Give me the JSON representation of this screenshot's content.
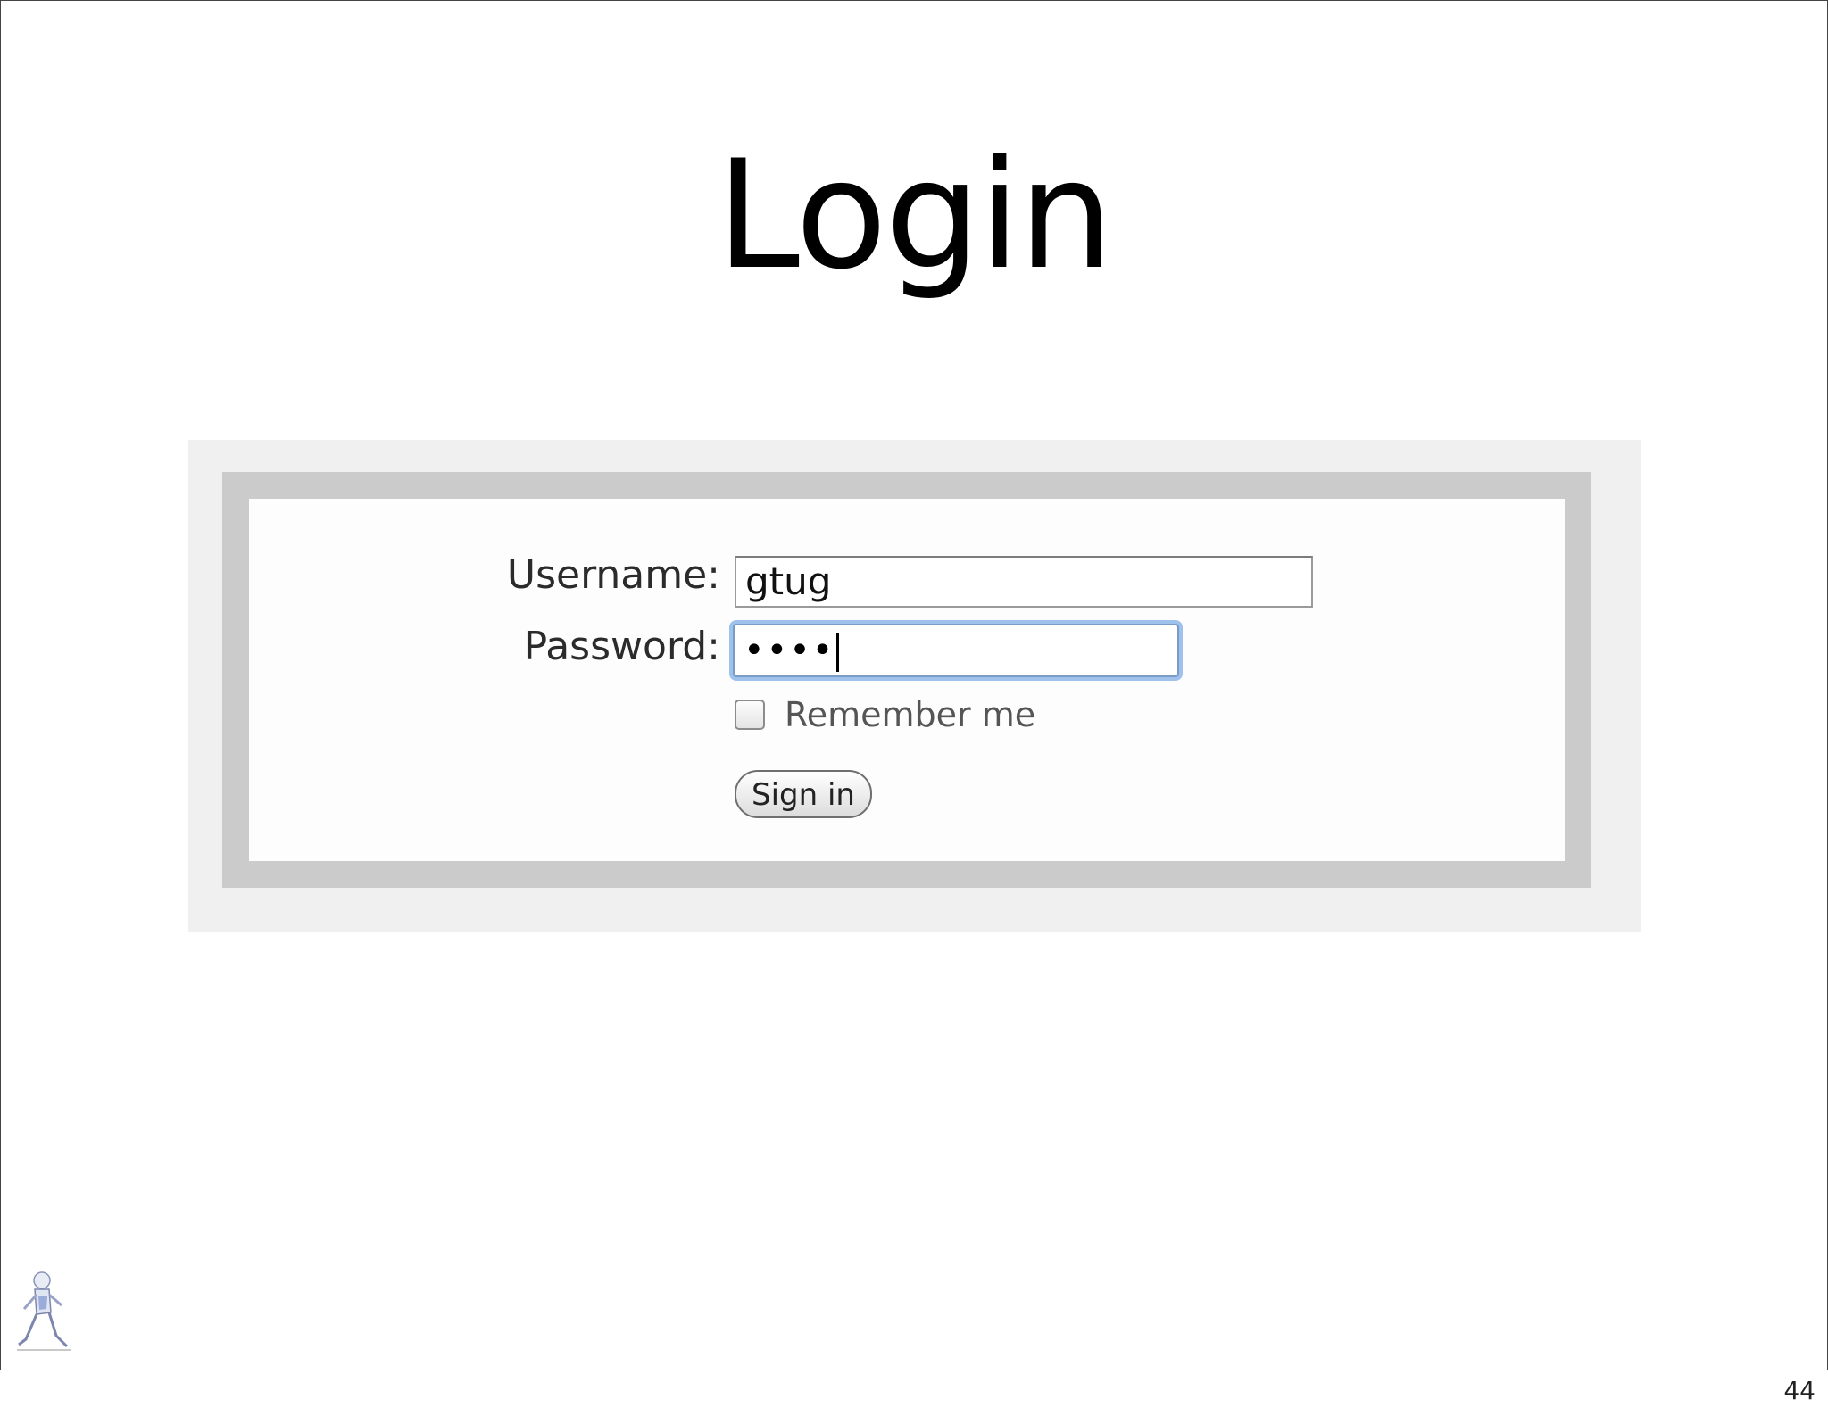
{
  "slide": {
    "title": "Login",
    "page_number": "44"
  },
  "form": {
    "username_label": "Username:",
    "username_value": "gtug",
    "password_label": "Password:",
    "password_value": "••••",
    "remember_label": "Remember me",
    "remember_checked": false,
    "signin_label": "Sign in"
  },
  "colors": {
    "focus_ring": "#9ec2ec",
    "panel_border": "#cbcbcb",
    "frame_background": "#f0f0f0"
  },
  "icons": {
    "footer_logo": "runner-mascot-icon"
  }
}
